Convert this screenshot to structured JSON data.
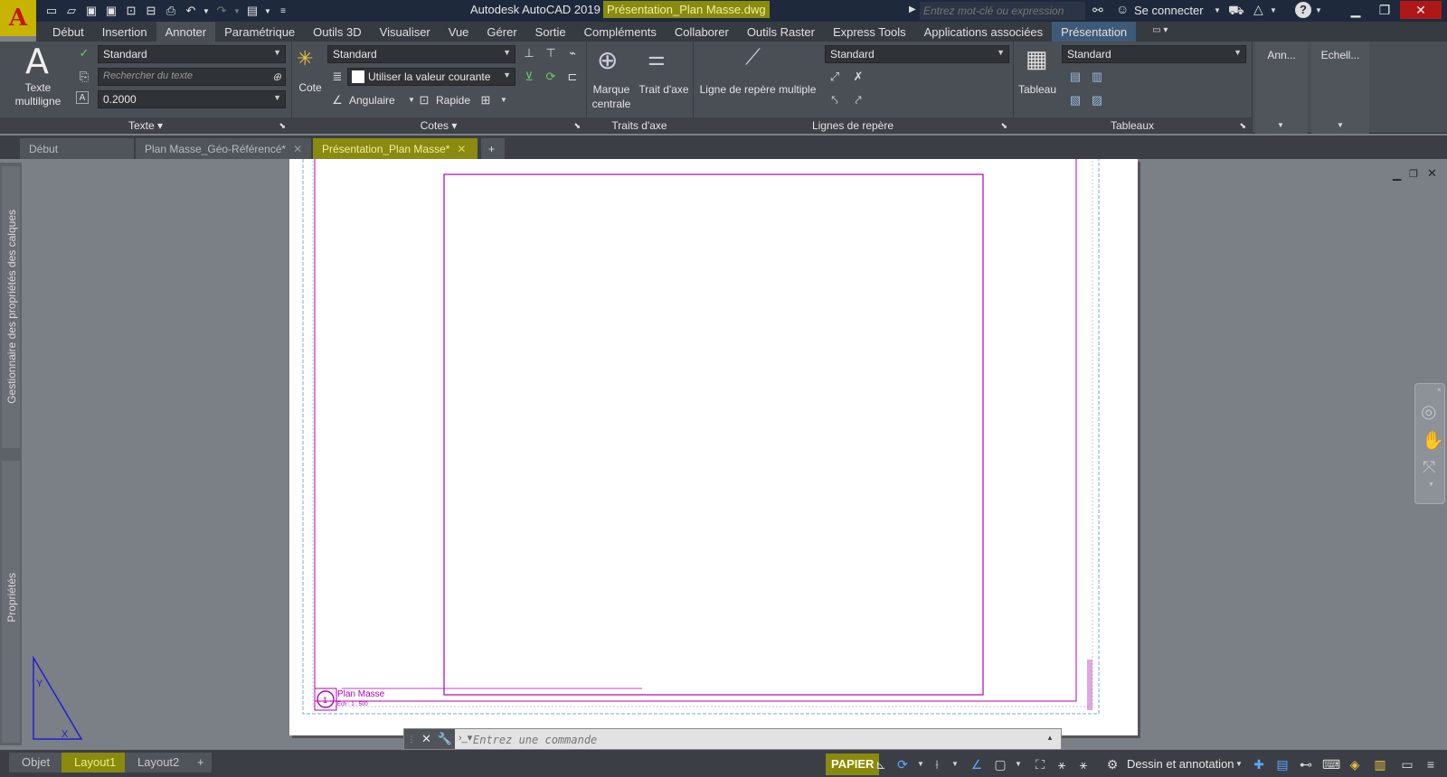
{
  "window": {
    "app_title": "Autodesk AutoCAD 2019",
    "file_title": "Présentation_Plan Masse.dwg",
    "search_placeholder": "Entrez mot-clé ou expression",
    "signin_label": "Se connecter"
  },
  "ribbon_tabs": [
    "Début",
    "Insertion",
    "Annoter",
    "Paramétrique",
    "Outils 3D",
    "Visualiser",
    "Vue",
    "Gérer",
    "Sortie",
    "Compléments",
    "Collaborer",
    "Outils Raster",
    "Express Tools",
    "Applications associées",
    "Présentation"
  ],
  "ribbon": {
    "text_panel": {
      "multiline_label_1": "Texte",
      "multiline_label_2": "multiligne",
      "style": "Standard",
      "find_placeholder": "Rechercher du texte",
      "height": "0.2000",
      "label": "Texte"
    },
    "dim_panel": {
      "cote_label": "Cote",
      "style": "Standard",
      "layer": "Utiliser la valeur courante",
      "angular_label": "Angulaire",
      "quick_label": "Rapide",
      "label": "Cotes"
    },
    "centerline_panel": {
      "center_mark_1": "Marque",
      "center_mark_2": "centrale",
      "centerline_label": "Trait d'axe",
      "label": "Traits d'axe"
    },
    "leader_panel": {
      "mleader_label": "Ligne de repère multiple",
      "style": "Standard",
      "label": "Lignes de repère"
    },
    "table_panel": {
      "table_label": "Tableau",
      "style": "Standard",
      "label": "Tableaux"
    },
    "ann_label": "Ann...",
    "scale_label": "Echell..."
  },
  "doc_tabs": [
    "Début",
    "Plan Masse_Géo-Référencé*",
    "Présentation_Plan Masse*"
  ],
  "side_palettes": {
    "layers": "Gestionnaire des propriétés des calques",
    "properties": "Propriétés"
  },
  "drawing": {
    "title_name": "Plan Masse",
    "title_scale": "Ech : 1 : 500",
    "title_number": "1"
  },
  "command_line": {
    "placeholder": "Entrez une commande"
  },
  "layout_tabs": [
    "Objet",
    "Layout1",
    "Layout2"
  ],
  "status": {
    "papier": "PAPIER",
    "workspace": "Dessin et annotation"
  },
  "colors": {
    "accent": "#8a8a10",
    "viewport": "#b000b0",
    "paper_border": "#7aa7d8"
  }
}
